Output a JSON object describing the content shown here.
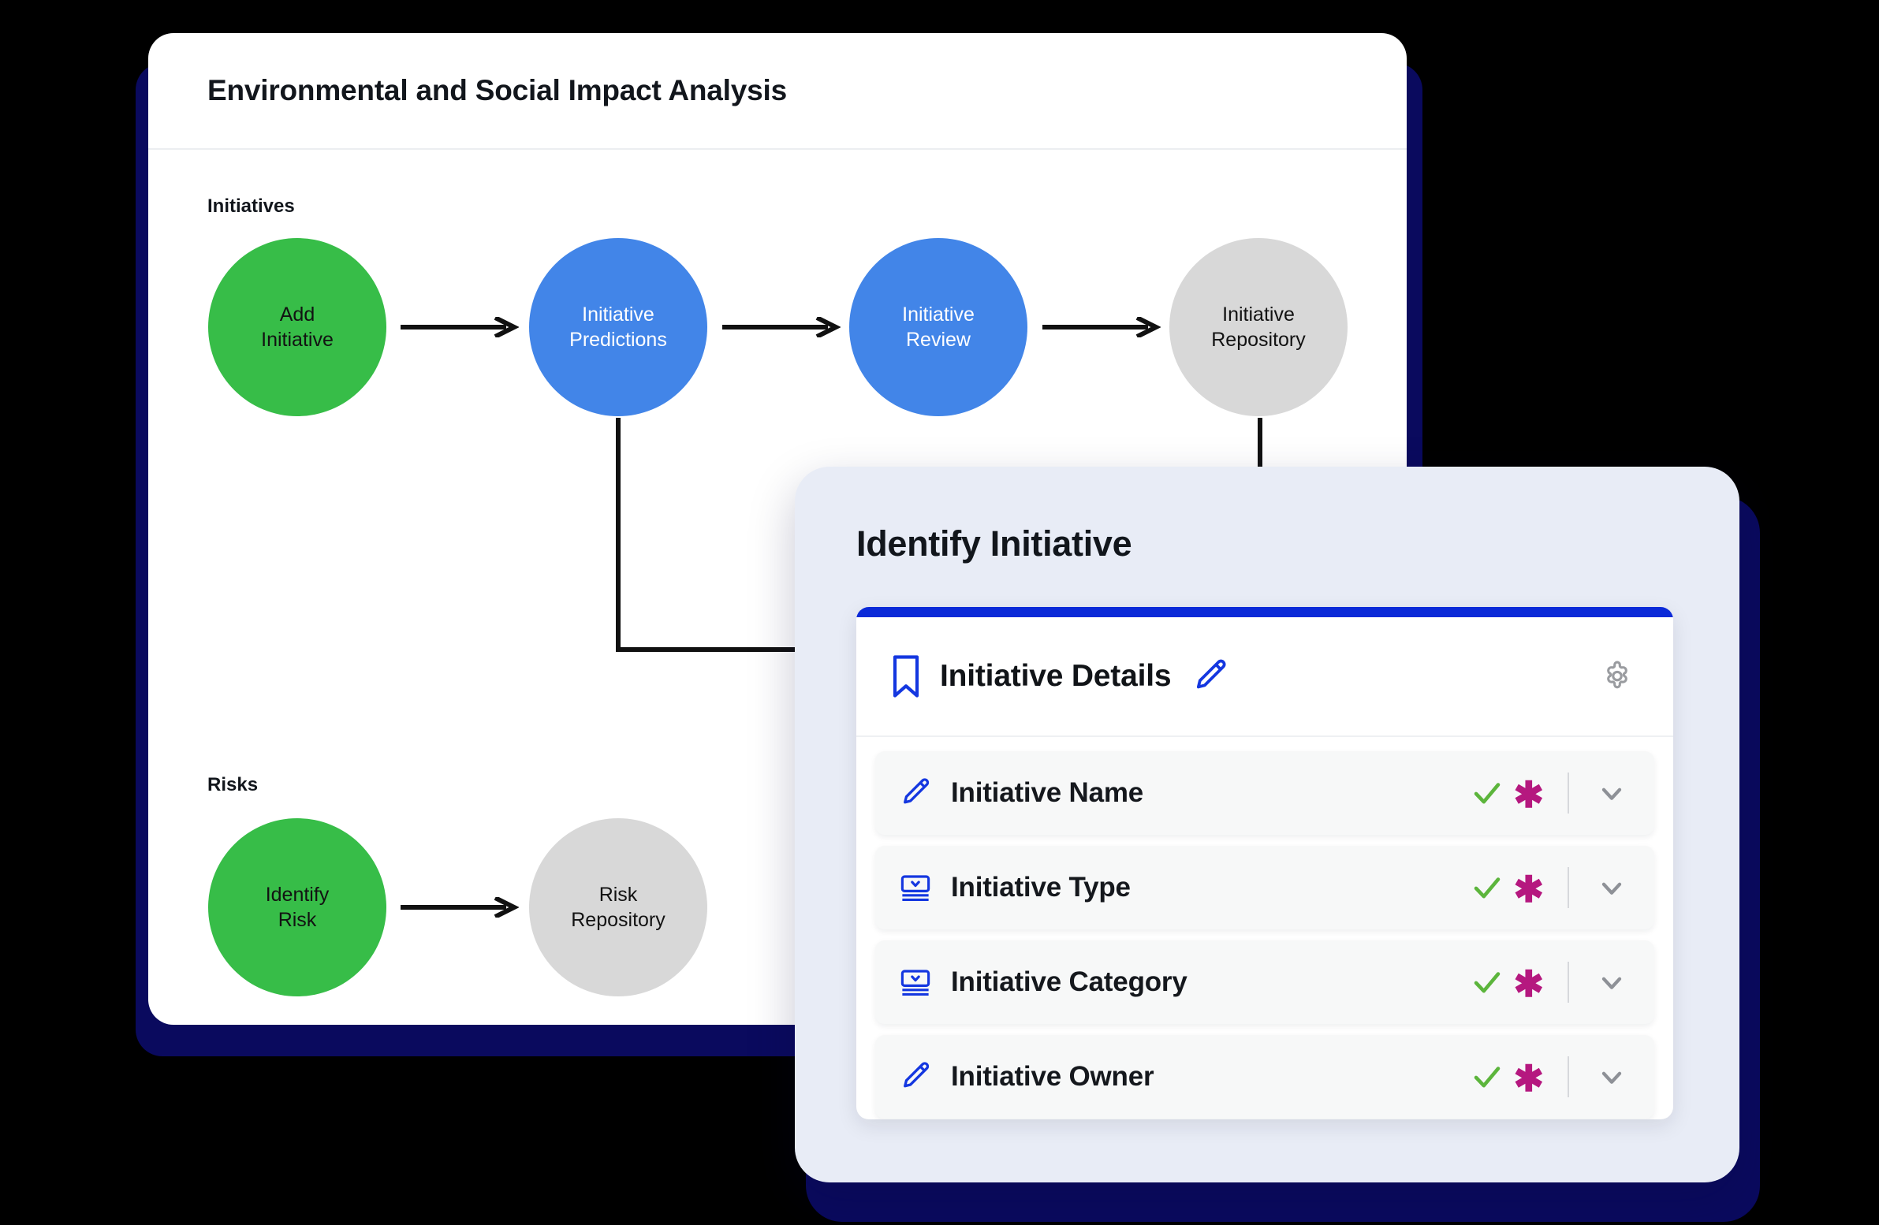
{
  "window": {
    "title": "Environmental and Social Impact Analysis"
  },
  "diagram": {
    "sections": [
      {
        "label": "Initiatives"
      },
      {
        "label": "Risks"
      }
    ],
    "initiatives_nodes": [
      {
        "label": "Add\nInitiative",
        "line1": "Add",
        "line2": "Initiative",
        "color": "#37bd48",
        "style": "green"
      },
      {
        "label": "Initiative\nPredictions",
        "line1": "Initiative",
        "line2": "Predictions",
        "color": "#4285e8",
        "style": "blue"
      },
      {
        "label": "Initiative\nReview",
        "line1": "Initiative",
        "line2": "Review",
        "color": "#4285e8",
        "style": "blue"
      },
      {
        "label": "Initiative\nRepository",
        "line1": "Initiative",
        "line2": "Repository",
        "color": "#d8d8d8",
        "style": "grey"
      }
    ],
    "risks_nodes": [
      {
        "line1": "Identify",
        "line2": "Risk",
        "color": "#37bd48",
        "style": "green"
      },
      {
        "line1": "Risk",
        "line2": "Repository",
        "color": "#d8d8d8",
        "style": "grey"
      }
    ],
    "arrow_color": "#111111"
  },
  "modal": {
    "title": "Identify Initiative",
    "accent_color": "#0b2ad8",
    "background_color": "#e8ecf6",
    "card": {
      "header": {
        "bookmark_icon": "bookmark-icon",
        "title": "Initiative Details",
        "edit_icon": "pencil-icon",
        "settings_icon": "gear-icon"
      },
      "rows": [
        {
          "icon": "pencil-icon",
          "label": "Initiative Name",
          "valid": "✓",
          "required": "✱",
          "expand": "chevron-down-icon"
        },
        {
          "icon": "dropdown-icon",
          "label": "Initiative Type",
          "valid": "✓",
          "required": "✱",
          "expand": "chevron-down-icon"
        },
        {
          "icon": "dropdown-icon",
          "label": "Initiative Category",
          "valid": "✓",
          "required": "✱",
          "expand": "chevron-down-icon"
        },
        {
          "icon": "pencil-icon",
          "label": "Initiative Owner",
          "valid": "✓",
          "required": "✱",
          "expand": "chevron-down-icon"
        }
      ]
    }
  },
  "colors": {
    "navy_shadow": "#0a0a5e",
    "accent_blue": "#0b2ad8",
    "node_blue": "#4285e8",
    "node_green": "#37bd48",
    "node_grey": "#d8d8d8",
    "check_green": "#5cb53c",
    "required_magenta": "#b5187f",
    "page_background": "#000000"
  }
}
